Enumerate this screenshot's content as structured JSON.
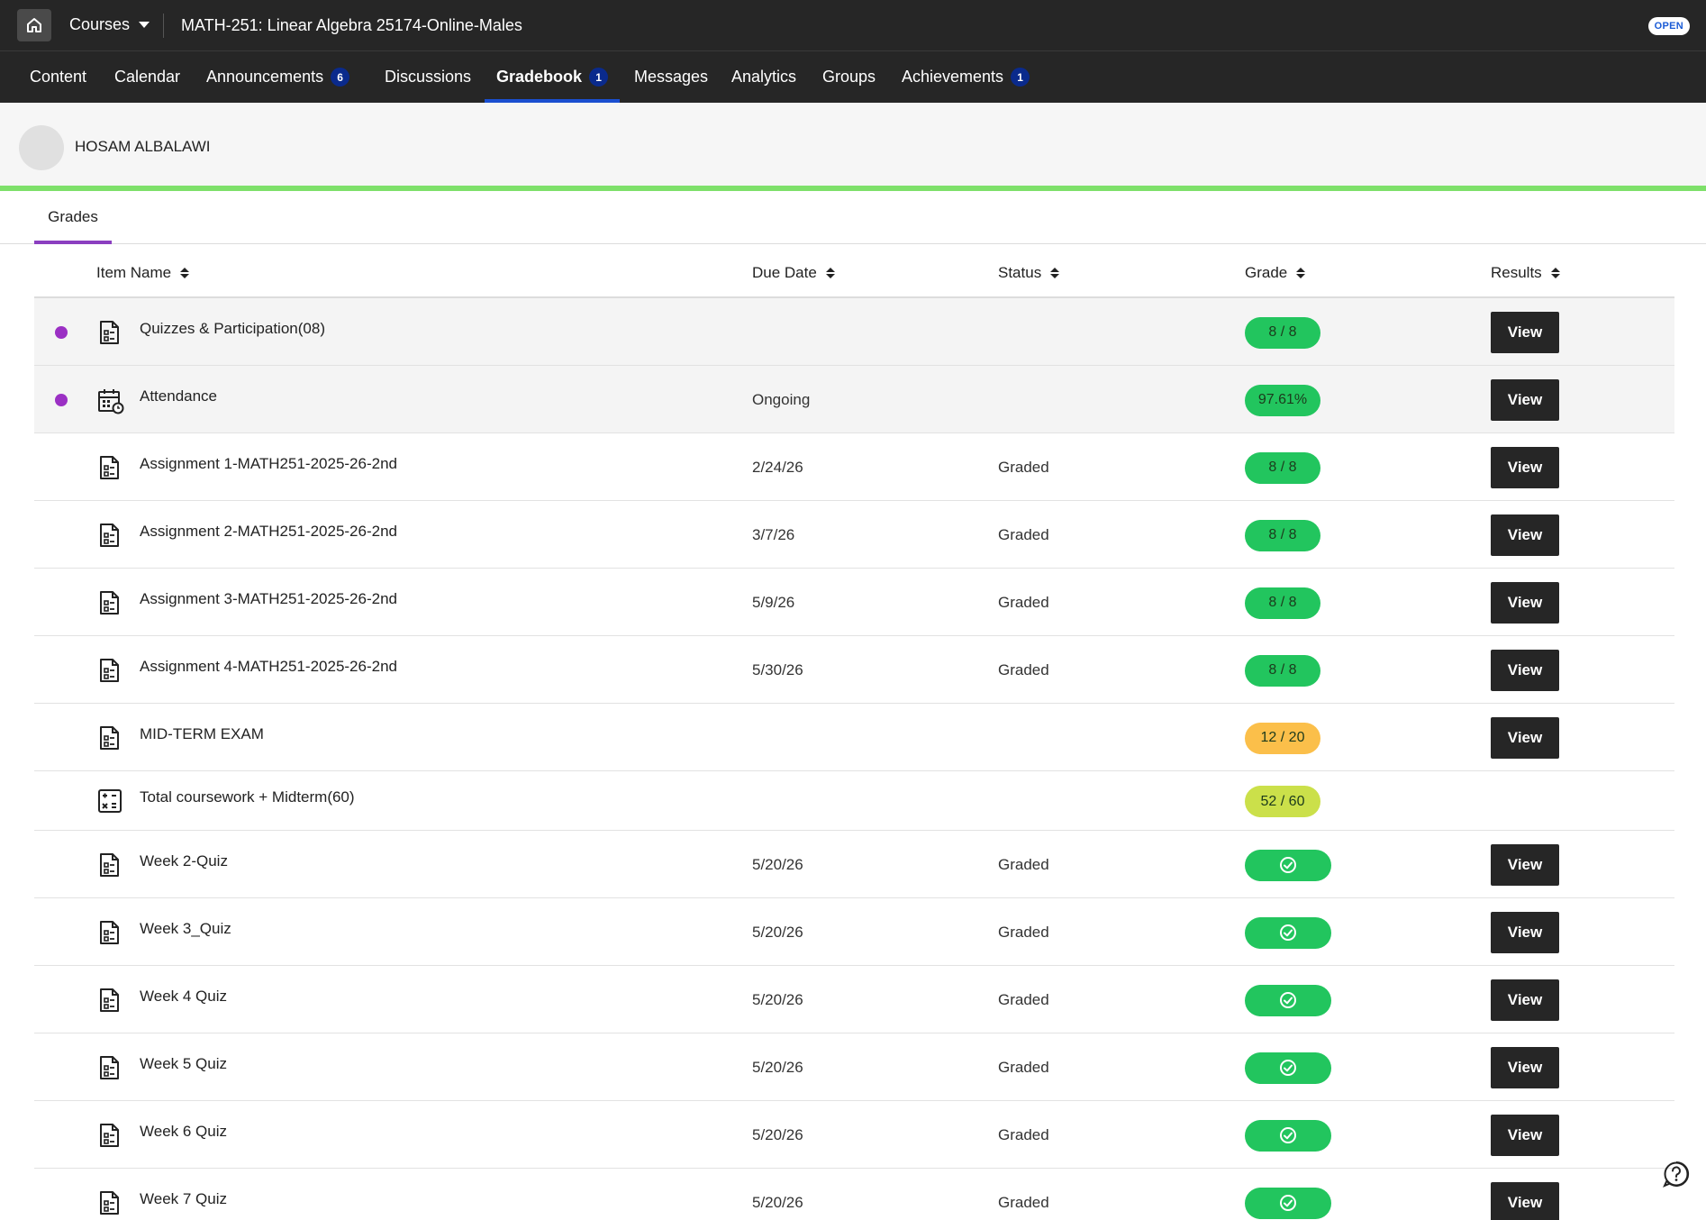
{
  "topbar": {
    "courses_label": "Courses",
    "course_title": "MATH-251: Linear Algebra 25174-Online-Males",
    "open_badge": "OPEN"
  },
  "nav": {
    "items": [
      {
        "label": "Content",
        "badge": null,
        "active": false
      },
      {
        "label": "Calendar",
        "badge": null,
        "active": false
      },
      {
        "label": "Announcements",
        "badge": "6",
        "active": false
      },
      {
        "label": "Discussions",
        "badge": null,
        "active": false
      },
      {
        "label": "Gradebook",
        "badge": "1",
        "active": true
      },
      {
        "label": "Messages",
        "badge": null,
        "active": false
      },
      {
        "label": "Analytics",
        "badge": null,
        "active": false
      },
      {
        "label": "Groups",
        "badge": null,
        "active": false
      },
      {
        "label": "Achievements",
        "badge": "1",
        "active": false
      }
    ]
  },
  "user": {
    "name": "HOSAM ALBALAWI"
  },
  "tabs": {
    "grades": "Grades"
  },
  "table": {
    "headers": {
      "item_name": "Item Name",
      "due_date": "Due Date",
      "status": "Status",
      "grade": "Grade",
      "results": "Results"
    },
    "rows": [
      {
        "name": "Quizzes & Participation(08)",
        "due": "",
        "status": "",
        "grade": "8 / 8",
        "grade_kind": "green",
        "has_view": true,
        "view_label": "View",
        "dot": true,
        "shaded": true,
        "icon": "document-icon"
      },
      {
        "name": "Attendance",
        "due": "Ongoing",
        "status": "",
        "grade": "97.61%",
        "grade_kind": "green",
        "has_view": true,
        "view_label": "View",
        "dot": true,
        "shaded": true,
        "icon": "attendance-calendar-icon"
      },
      {
        "name": "Assignment 1-MATH251-2025-26-2nd",
        "due": "2/24/26",
        "status": "Graded",
        "grade": "8 / 8",
        "grade_kind": "green",
        "has_view": true,
        "view_label": "View",
        "dot": false,
        "shaded": false,
        "icon": "document-icon"
      },
      {
        "name": "Assignment 2-MATH251-2025-26-2nd",
        "due": "3/7/26",
        "status": "Graded",
        "grade": "8 / 8",
        "grade_kind": "green",
        "has_view": true,
        "view_label": "View",
        "dot": false,
        "shaded": false,
        "icon": "document-icon"
      },
      {
        "name": "Assignment 3-MATH251-2025-26-2nd",
        "due": "5/9/26",
        "status": "Graded",
        "grade": "8 / 8",
        "grade_kind": "green",
        "has_view": true,
        "view_label": "View",
        "dot": false,
        "shaded": false,
        "icon": "document-icon"
      },
      {
        "name": "Assignment 4-MATH251-2025-26-2nd",
        "due": "5/30/26",
        "status": "Graded",
        "grade": "8 / 8",
        "grade_kind": "green",
        "has_view": true,
        "view_label": "View",
        "dot": false,
        "shaded": false,
        "icon": "document-icon"
      },
      {
        "name": "MID-TERM EXAM",
        "due": "",
        "status": "",
        "grade": "12 / 20",
        "grade_kind": "orange",
        "has_view": true,
        "view_label": "View",
        "dot": false,
        "shaded": false,
        "icon": "document-icon"
      },
      {
        "name": "Total coursework + Midterm(60)",
        "due": "",
        "status": "",
        "grade": "52 / 60",
        "grade_kind": "lime",
        "has_view": false,
        "view_label": "",
        "dot": false,
        "shaded": false,
        "icon": "calculator-icon"
      },
      {
        "name": "Week 2-Quiz",
        "due": "5/20/26",
        "status": "Graded",
        "grade": "",
        "grade_kind": "check",
        "has_view": true,
        "view_label": "View",
        "dot": false,
        "shaded": false,
        "icon": "document-icon"
      },
      {
        "name": "Week 3_Quiz",
        "due": "5/20/26",
        "status": "Graded",
        "grade": "",
        "grade_kind": "check",
        "has_view": true,
        "view_label": "View",
        "dot": false,
        "shaded": false,
        "icon": "document-icon"
      },
      {
        "name": "Week 4 Quiz",
        "due": "5/20/26",
        "status": "Graded",
        "grade": "",
        "grade_kind": "check",
        "has_view": true,
        "view_label": "View",
        "dot": false,
        "shaded": false,
        "icon": "document-icon"
      },
      {
        "name": "Week 5 Quiz",
        "due": "5/20/26",
        "status": "Graded",
        "grade": "",
        "grade_kind": "check",
        "has_view": true,
        "view_label": "View",
        "dot": false,
        "shaded": false,
        "icon": "document-icon"
      },
      {
        "name": "Week 6 Quiz",
        "due": "5/20/26",
        "status": "Graded",
        "grade": "",
        "grade_kind": "check",
        "has_view": true,
        "view_label": "View",
        "dot": false,
        "shaded": false,
        "icon": "document-icon"
      },
      {
        "name": "Week 7 Quiz",
        "due": "5/20/26",
        "status": "Graded",
        "grade": "",
        "grade_kind": "check",
        "has_view": true,
        "view_label": "View",
        "dot": false,
        "shaded": false,
        "icon": "document-icon"
      }
    ]
  },
  "colors": {
    "grade_green": "#22c55e",
    "grade_orange": "#fbbf4a",
    "grade_lime": "#cbe04a",
    "dot_purple": "#9b30c4",
    "tab_underline": "#8b3fc0",
    "nav_underline": "#1a4fd0",
    "band_green": "#7ee06a"
  }
}
